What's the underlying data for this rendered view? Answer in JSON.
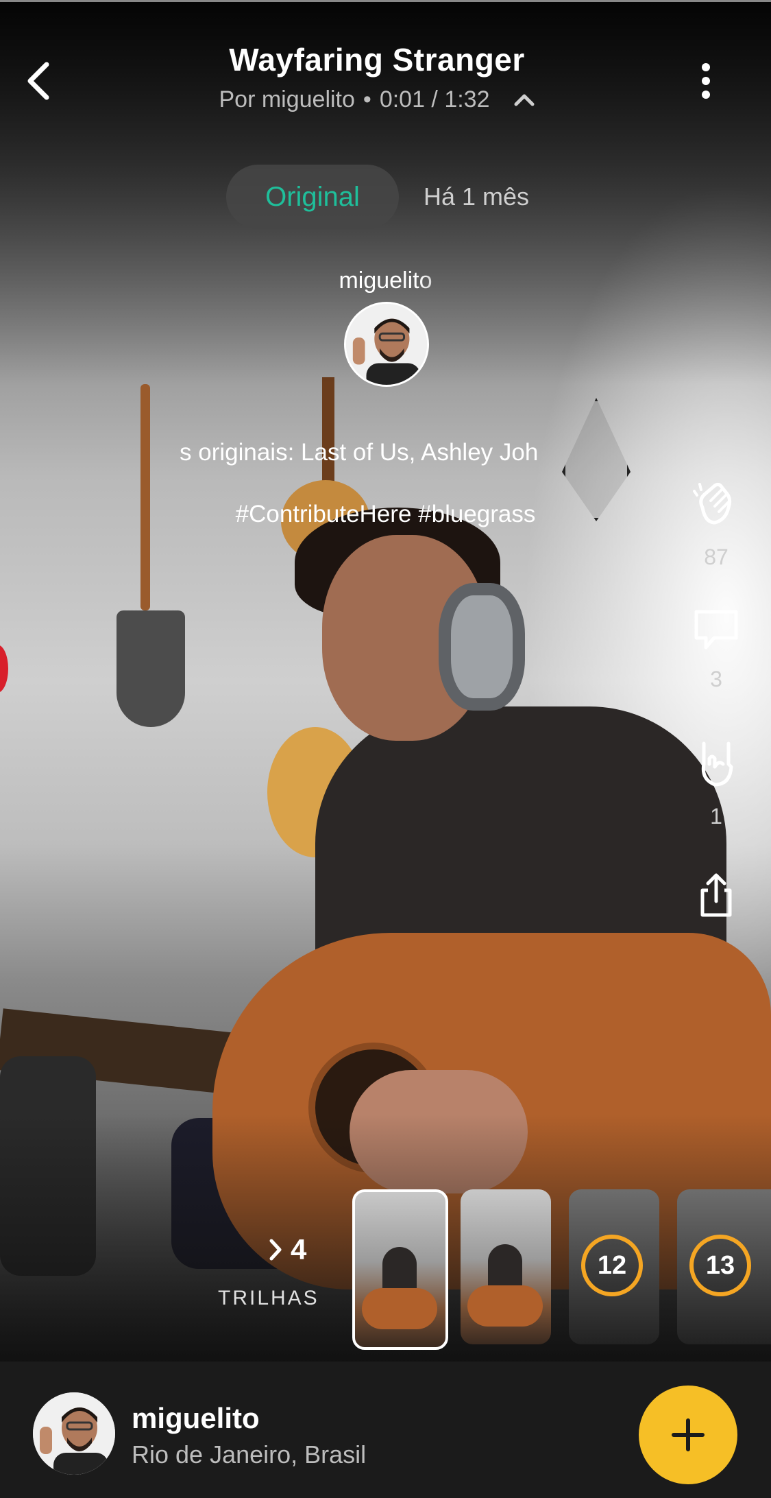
{
  "header": {
    "title": "Wayfaring Stranger",
    "subtitle_prefix": "Por miguelito",
    "separator": "•",
    "time": "0:01 / 1:32",
    "back_icon": "chevron-left-icon",
    "more_icon": "vertical-ellipsis-icon",
    "collapse_icon": "chevron-up-icon"
  },
  "tabs": {
    "original": "Original",
    "date": "Há 1 mês"
  },
  "post": {
    "author": "miguelito",
    "description_visible": "s originais: Last of Us, Ashley Joh",
    "tags": "#ContributeHere #bluegrass"
  },
  "actions": {
    "applause_icon": "applause-icon",
    "applause_count": "87",
    "comment_icon": "comment-icon",
    "comment_count": "3",
    "rock_icon": "rock-hand-icon",
    "rock_count": "1",
    "share_icon": "share-icon"
  },
  "tracks": {
    "count": "4",
    "label": "TRILHAS",
    "items": [
      {
        "selected": true
      },
      {
        "selected": false
      },
      {
        "badge": "12"
      },
      {
        "badge": "13"
      }
    ]
  },
  "footer": {
    "username": "miguelito",
    "location": "Rio de Janeiro, Brasil",
    "add_icon": "plus-icon"
  },
  "colors": {
    "accent_green": "#1fbf9b",
    "accent_orange": "#f5a623",
    "fab_yellow": "#f6bf26"
  }
}
